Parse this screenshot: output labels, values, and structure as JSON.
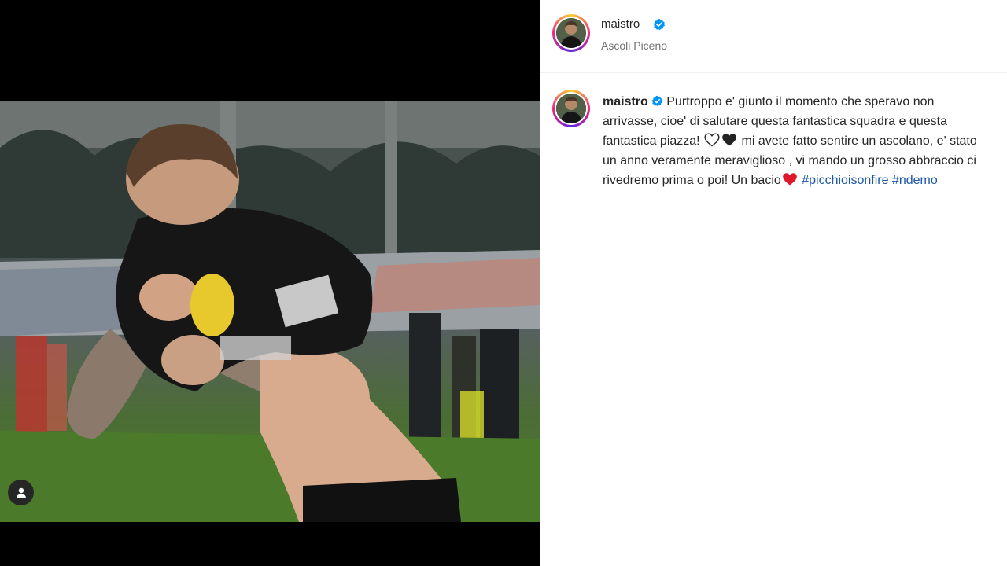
{
  "post": {
    "media": {
      "alt": "",
      "user_tag_icon": "person-icon"
    },
    "header": {
      "username": "maistro",
      "verified": true,
      "location": "Ascoli Piceno"
    },
    "caption": {
      "username": "maistro",
      "verified": true,
      "line1": "Purtroppo e' giunto il momento che speravo non arrivasse, cioe' di salutare questa fantastica squadra e questa fantastica piazza!",
      "emoji1": "white-heart-icon",
      "emoji2": "black-heart-icon",
      "line2": "mi avete fatto sentire un ascolano, e' stato un anno veramente meraviglioso , vi mando un grosso abbraccio ci rivedremo prima o poi! Un bacio",
      "emoji3": "red-heart-icon",
      "hashtags": [
        "#picchioisonfire",
        "#ndemo"
      ]
    },
    "colors": {
      "verified_blue": "#0095f6",
      "hashtag_blue": "#1c57a8",
      "text": "#262626",
      "secondary_text": "#737373"
    }
  }
}
